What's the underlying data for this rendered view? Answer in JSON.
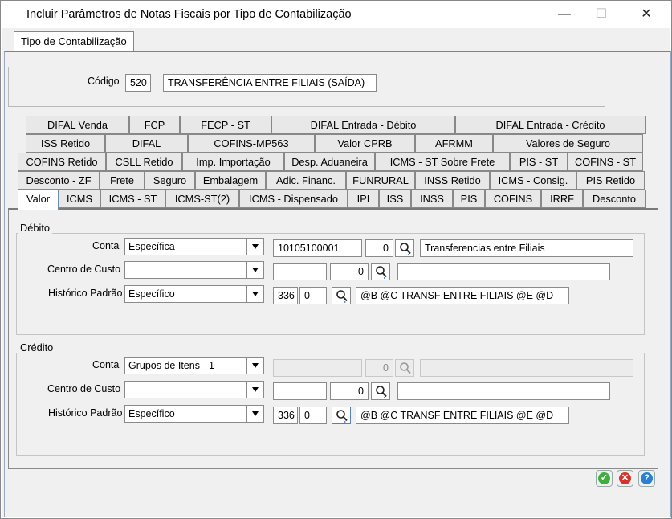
{
  "window": {
    "title": "Incluir Parâmetros de Notas Fiscais por Tipo de Contabilização",
    "controls": {
      "minimize": "—",
      "maximize": "☐",
      "close": "✕"
    }
  },
  "outer_tab": {
    "label": "Tipo de Contabilização"
  },
  "codigo": {
    "label": "Código",
    "value": "520",
    "description": "TRANSFERÊNCIA ENTRE FILIAIS (SAÍDA)"
  },
  "tabs": {
    "row1": [
      "DIFAL Venda",
      "FCP",
      "FECP - ST",
      "DIFAL Entrada - Débito",
      "DIFAL Entrada - Crédito"
    ],
    "row2": [
      "ISS Retido",
      "DIFAL",
      "COFINS-MP563",
      "Valor CPRB",
      "AFRMM",
      "Valores de Seguro"
    ],
    "row3": [
      "COFINS Retido",
      "CSLL Retido",
      "Imp. Importação",
      "Desp. Aduaneira",
      "ICMS - ST Sobre Frete",
      "PIS - ST",
      "COFINS - ST"
    ],
    "row4": [
      "Desconto - ZF",
      "Frete",
      "Seguro",
      "Embalagem",
      "Adic. Financ.",
      "FUNRURAL",
      "INSS Retido",
      "ICMS - Consig.",
      "PIS Retido"
    ],
    "row5": [
      "Valor",
      "ICMS",
      "ICMS - ST",
      "ICMS-ST(2)",
      "ICMS - Dispensado",
      "IPI",
      "ISS",
      "INSS",
      "PIS",
      "COFINS",
      "IRRF",
      "Desconto"
    ],
    "active": "Valor"
  },
  "debito": {
    "title": "Débito",
    "conta": {
      "label": "Conta",
      "select": "Específica",
      "code": "10105100001",
      "digit": "0",
      "description": "Transferencias entre Filiais"
    },
    "centro": {
      "label": "Centro de Custo",
      "select": "",
      "code": "",
      "digit": "0",
      "description": ""
    },
    "historico": {
      "label": "Histórico Padrão",
      "select": "Específico",
      "code": "336",
      "digit": "0",
      "description": "@B @C TRANSF ENTRE FILIAIS @E @D"
    }
  },
  "credito": {
    "title": "Crédito",
    "conta": {
      "label": "Conta",
      "select": "Grupos de Itens - 1",
      "code": "",
      "digit": "0",
      "description": ""
    },
    "centro": {
      "label": "Centro de Custo",
      "select": "",
      "code": "",
      "digit": "0",
      "description": ""
    },
    "historico": {
      "label": "Histórico Padrão",
      "select": "Específico",
      "code": "336",
      "digit": "0",
      "description": "@B @C TRANSF ENTRE FILIAIS @E @D"
    }
  },
  "buttons": {
    "ok": "✓",
    "cancel": "✕",
    "help": "?"
  },
  "colors": {
    "ok": "#3fae3f",
    "cancel": "#d8332b",
    "help": "#2a7fd4",
    "tab_border_active": "#6f8ab0"
  },
  "icons": {
    "lookup": "magnifier-icon",
    "dropdown": "chevron-down-icon"
  }
}
